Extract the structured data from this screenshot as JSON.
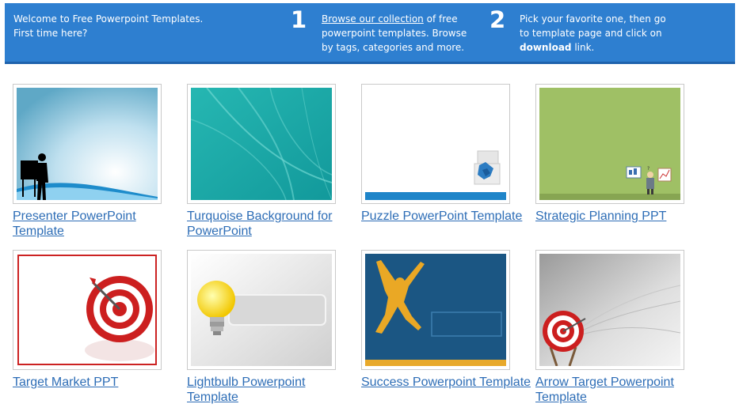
{
  "banner": {
    "welcome_line1": "Welcome to Free Powerpoint Templates.",
    "welcome_line2": "First time here?",
    "step1_number": "1",
    "step1_link": "Browse our collection",
    "step1_text": " of free powerpoint templates. Browse by tags, categories and more.",
    "step2_number": "2",
    "step2_text_before": "Pick your favorite one, then go to template page and click on ",
    "step2_bold": "download",
    "step2_text_after": " link."
  },
  "templates": [
    {
      "title": "Presenter PowerPoint Template",
      "icon": "presenter-thumbnail"
    },
    {
      "title": "Turquoise Background for PowerPoint",
      "icon": "turquoise-thumbnail"
    },
    {
      "title": "Puzzle PowerPoint Template",
      "icon": "puzzle-thumbnail"
    },
    {
      "title": "Strategic Planning PPT",
      "icon": "strategic-planning-thumbnail"
    },
    {
      "title": "Target Market PPT",
      "icon": "target-thumbnail"
    },
    {
      "title": "Lightbulb Powerpoint Template",
      "icon": "lightbulb-thumbnail"
    },
    {
      "title": "Success Powerpoint Template",
      "icon": "success-thumbnail"
    },
    {
      "title": "Arrow Target Powerpoint Template",
      "icon": "arrow-target-thumbnail"
    }
  ],
  "colors": {
    "banner": "#2e7fd0",
    "link": "#2d6db6"
  }
}
